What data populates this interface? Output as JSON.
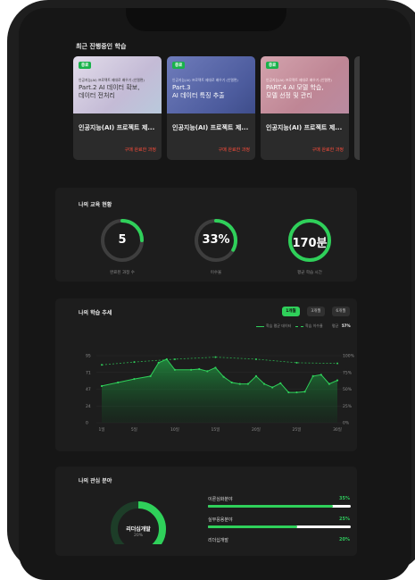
{
  "sections": {
    "recent": "최근 진행중인 학습",
    "status": "나의 교육 현황",
    "trend": "나의 학습 추세",
    "interest": "나의 관심 분야"
  },
  "courses": [
    {
      "badge": "종료",
      "sub": "인공지능(AI) 프로젝트 제대로 배우기 (인텔편)",
      "heading": "Part.2  AI 데이터 확보,\n데이터 전처리",
      "title": "인공지능(AI) 프로젝트 제...",
      "status": "구매 완료한 과정",
      "color": "#c7bfd9"
    },
    {
      "badge": "종료",
      "sub": "인공지능(AI) 프로젝트 제대로 배우기 (인텔편)",
      "heading": "Part.3\nAI 데이터 특징 추출",
      "title": "인공지능(AI) 프로젝트 제...",
      "status": "구매 완료한 과정",
      "color": "#5a6cab"
    },
    {
      "badge": "종료",
      "sub": "인공지능(AI) 프로젝트 제대로 배우기 (인텔편)",
      "heading": "PART.4  AI 모델 학습,\n모델 선정 및 관리",
      "title": "인공지능(AI) 프로젝트 제...",
      "status": "구매 완료한 과정",
      "color": "#c7929d"
    }
  ],
  "stats": [
    {
      "value": "5",
      "label": "완료된 과정 수",
      "progress": 0.25
    },
    {
      "value": "33%",
      "label": "이수율",
      "progress": 0.33
    },
    {
      "value": "170분",
      "label": "평균 학습 시간",
      "progress": 1.0
    }
  ],
  "trend_tabs": [
    "1개월",
    "3개월",
    "6개월"
  ],
  "legend": {
    "time": "학습 평균 데이터",
    "rate": "학습 이수율",
    "avg_prefix": "평균",
    "avg_value": "57%"
  },
  "chart_data": {
    "type": "area",
    "x_tick_labels": [
      "1일",
      "5일",
      "10일",
      "15일",
      "20일",
      "25일",
      "30일"
    ],
    "y_left_ticks": [
      "95",
      "71",
      "47",
      "24",
      "0"
    ],
    "y_right_ticks": [
      "100%",
      "75%",
      "50%",
      "25%",
      "0%"
    ],
    "xlim": [
      1,
      30
    ],
    "ylim": [
      0,
      95
    ],
    "series": [
      {
        "name": "학습 평균 데이터",
        "x": [
          1,
          3,
          5,
          7,
          8,
          9,
          10,
          12,
          13,
          14,
          15,
          16,
          17,
          18,
          19,
          20,
          21,
          22,
          23,
          24,
          25,
          26,
          27,
          28,
          29,
          30
        ],
        "values": [
          52,
          57,
          62,
          66,
          85,
          90,
          75,
          75,
          76,
          73,
          78,
          65,
          57,
          55,
          55,
          66,
          55,
          50,
          56,
          43,
          43,
          44,
          66,
          68,
          55,
          60
        ]
      },
      {
        "name": "학습 이수율",
        "x": [
          1,
          5,
          10,
          15,
          20,
          25,
          30
        ],
        "values": [
          82,
          86,
          90,
          93,
          90,
          85,
          84
        ]
      }
    ]
  },
  "interest_donut": {
    "label": "리더십개발",
    "pct": "20%"
  },
  "interests": [
    {
      "name": "이론심화분야",
      "pct": "35%",
      "value": 0.35
    },
    {
      "name": "실무응용분야",
      "pct": "25%",
      "value": 0.25
    },
    {
      "name": "리더십개발",
      "pct": "20%",
      "value": 0.2
    }
  ],
  "colors": {
    "accent": "#2fd05a",
    "danger": "#ff4d3b"
  }
}
